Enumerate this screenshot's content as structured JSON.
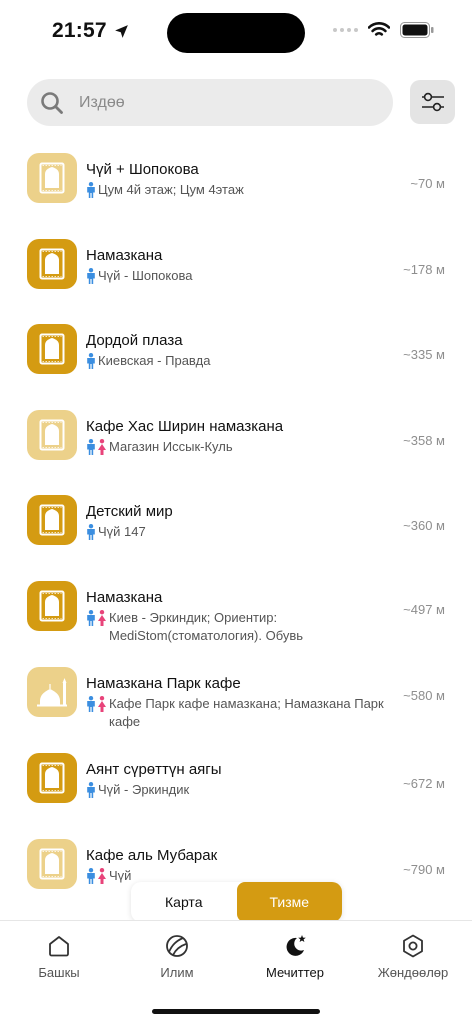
{
  "status": {
    "time": "21:57"
  },
  "search": {
    "placeholder": "Издөө"
  },
  "places": [
    {
      "name": "Чүй + Шопокова",
      "address": "Цум 4й этаж; Цум 4этаж",
      "distance": "~70 м",
      "tone": "light",
      "icon": "prayer-rug-icon",
      "genders": [
        "male"
      ]
    },
    {
      "name": "Намазкана",
      "address": "Чүй - Шопокова",
      "distance": "~178 м",
      "tone": "dark",
      "icon": "prayer-rug-icon",
      "genders": [
        "male"
      ]
    },
    {
      "name": "Дордой плаза",
      "address": "Киевская - Правда",
      "distance": "~335 м",
      "tone": "dark",
      "icon": "prayer-rug-icon",
      "genders": [
        "male"
      ]
    },
    {
      "name": "Кафе Хас Ширин намазкана",
      "address": "Магазин Иссык-Куль",
      "distance": "~358 м",
      "tone": "light",
      "icon": "prayer-rug-icon",
      "genders": [
        "male",
        "female"
      ]
    },
    {
      "name": "Детский мир",
      "address": "Чүй 147",
      "distance": "~360 м",
      "tone": "dark",
      "icon": "prayer-rug-icon",
      "genders": [
        "male"
      ]
    },
    {
      "name": "Намазкана",
      "address": "Киев - Эркиндик; Ориентир: MediStom(стоматология). Обувь",
      "distance": "~497 м",
      "tone": "dark",
      "icon": "prayer-rug-icon",
      "genders": [
        "male",
        "female"
      ]
    },
    {
      "name": "Намазкана Парк кафе",
      "address": "Кафе Парк кафе намазкана; Намазкана Парк кафе",
      "distance": "~580 м",
      "tone": "light",
      "icon": "mosque-icon",
      "genders": [
        "male",
        "female"
      ]
    },
    {
      "name": "Аянт сүрөттүн аягы",
      "address": "Чүй - Эркиндик",
      "distance": "~672 м",
      "tone": "dark",
      "icon": "prayer-rug-icon",
      "genders": [
        "male"
      ]
    },
    {
      "name": "Кафе аль Мубарак",
      "address": "Чүй",
      "distance": "~790 м",
      "tone": "light",
      "icon": "prayer-rug-icon",
      "genders": [
        "male",
        "female"
      ]
    }
  ],
  "segment": {
    "map": "Карта",
    "list": "Тизме",
    "selected": "list"
  },
  "tabs": [
    {
      "label": "Башкы",
      "icon": "home-icon"
    },
    {
      "label": "Илим",
      "icon": "knowledge-icon"
    },
    {
      "label": "Мечиттер",
      "icon": "moon-star-icon",
      "active": true
    },
    {
      "label": "Жөндөөлөр",
      "icon": "settings-icon"
    }
  ],
  "colors": {
    "accent": "#d49b12",
    "accent_light": "#ecd18a",
    "male": "#3b8ee0",
    "female": "#e8437a"
  }
}
